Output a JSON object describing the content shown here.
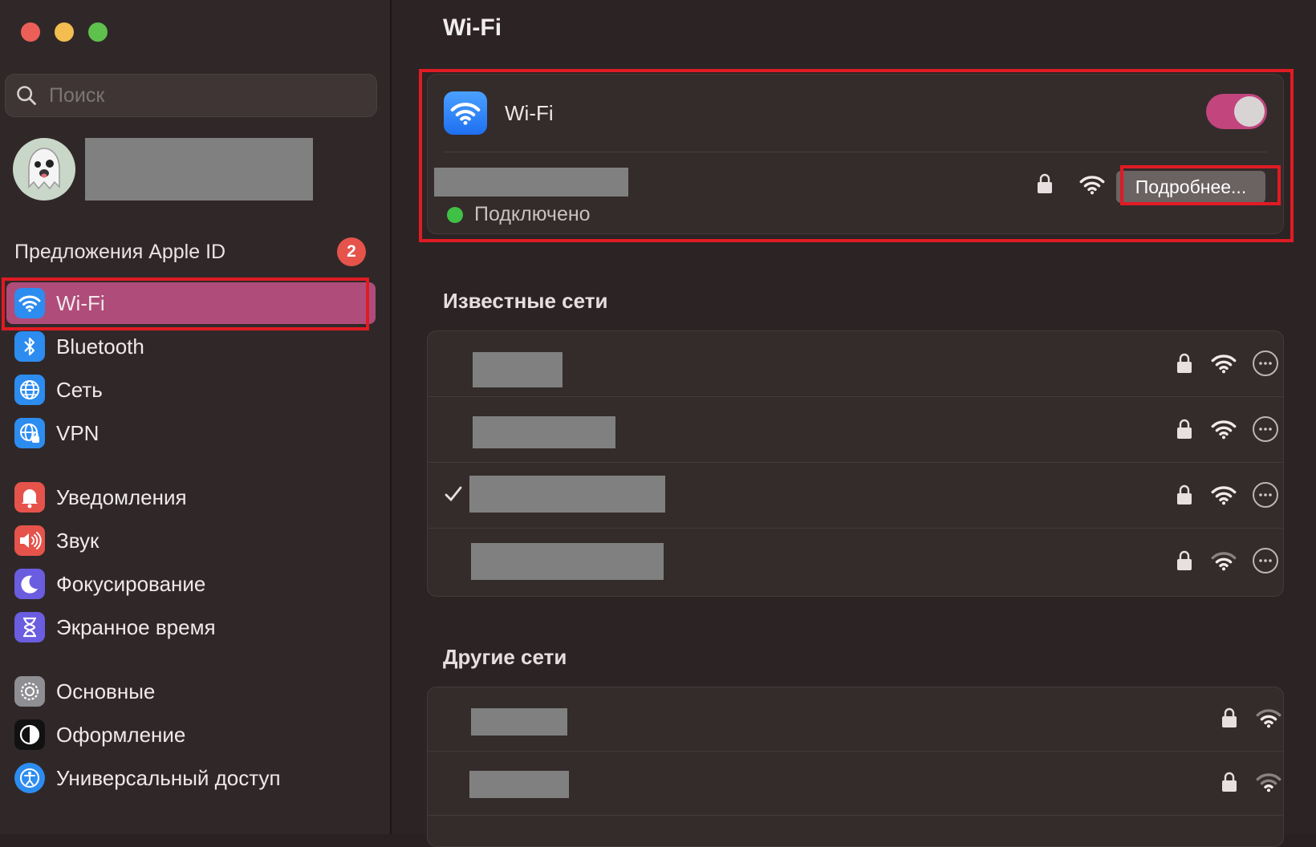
{
  "sidebar": {
    "search_placeholder": "Поиск",
    "apple_id": {
      "label": "Предложения Apple ID",
      "badge": "2"
    },
    "items": [
      {
        "label": "Wi-Fi",
        "icon": "wifi-icon",
        "color": "#2d8cf0",
        "active": true
      },
      {
        "label": "Bluetooth",
        "icon": "bluetooth-icon",
        "color": "#2d8cf0"
      },
      {
        "label": "Сеть",
        "icon": "globe-icon",
        "color": "#2d8cf0"
      },
      {
        "label": "VPN",
        "icon": "vpn-globe-icon",
        "color": "#2d8cf0"
      },
      {
        "label": "Уведомления",
        "icon": "bell-icon",
        "color": "#e5534b"
      },
      {
        "label": "Звук",
        "icon": "speaker-icon",
        "color": "#e5534b"
      },
      {
        "label": "Фокусирование",
        "icon": "moon-icon",
        "color": "#6a5de0"
      },
      {
        "label": "Экранное время",
        "icon": "hourglass-icon",
        "color": "#6a5de0"
      },
      {
        "label": "Основные",
        "icon": "gear-icon",
        "color": "#8e8e93"
      },
      {
        "label": "Оформление",
        "icon": "appearance-icon",
        "color": "#111111"
      },
      {
        "label": "Универсальный доступ",
        "icon": "accessibility-icon",
        "color": "#2d8cf0"
      }
    ]
  },
  "main": {
    "title": "Wi-Fi",
    "wifi_card": {
      "label": "Wi-Fi",
      "enabled": true,
      "status": "Подключено",
      "details_button": "Подробнее..."
    },
    "known_networks_title": "Известные сети",
    "other_networks_title": "Другие сети"
  },
  "colors": {
    "accent": "#b04c7a",
    "toggle_on": "#c2457e",
    "highlight": "#e01b24",
    "connected": "#3fc146"
  }
}
